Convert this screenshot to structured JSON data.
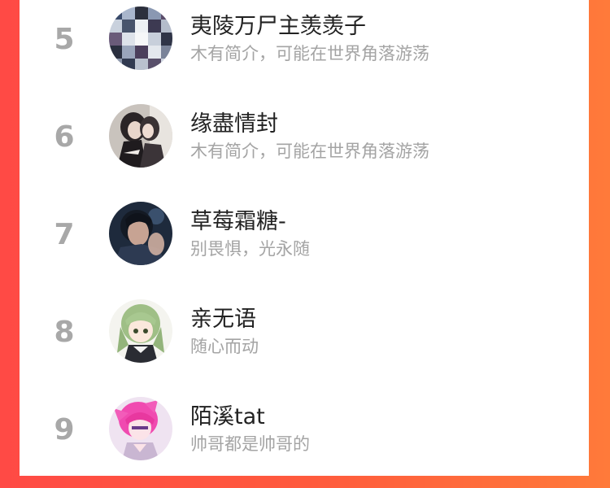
{
  "ranking": {
    "items": [
      {
        "rank": "5",
        "name": "夷陵万尸主羡羡子",
        "bio": "木有简介，可能在世界角落游荡",
        "avatar_icon": "collage-avatar-icon"
      },
      {
        "rank": "6",
        "name": "缘盡情封",
        "bio": "木有简介，可能在世界角落游荡",
        "avatar_icon": "couple-illustration-avatar-icon"
      },
      {
        "rank": "7",
        "name": "草莓霜糖-",
        "bio": "别畏惧，光永随",
        "avatar_icon": "dark-hair-man-avatar-icon"
      },
      {
        "rank": "8",
        "name": "亲无语",
        "bio": "随心而动",
        "avatar_icon": "green-hair-anime-avatar-icon"
      },
      {
        "rank": "9",
        "name": "陌溪tat",
        "bio": "帅哥都是帅哥的",
        "avatar_icon": "pink-hair-anime-avatar-icon"
      }
    ]
  }
}
